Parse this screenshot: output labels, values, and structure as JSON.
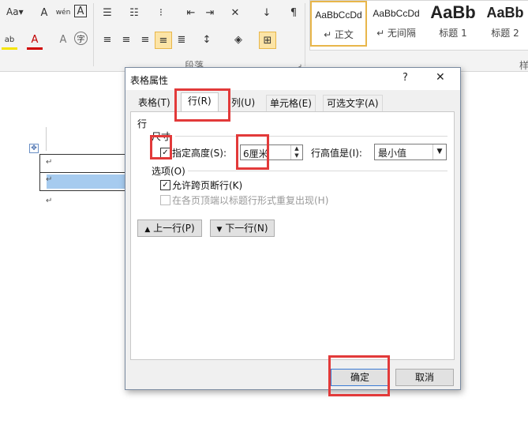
{
  "ribbon": {
    "font_size_label": "Aa",
    "phonetic_icon_label": "wén",
    "letter_a": "A",
    "char_label": "字",
    "shading_label": "ab",
    "paragraph_group_label": "段落",
    "styles_group_label": "样",
    "styles": [
      {
        "sample": "AaBbCcDd",
        "name": "↵ 正文"
      },
      {
        "sample": "AaBbCcDd",
        "name": "↵ 无间隔"
      },
      {
        "sample": "AaBb",
        "name": "标题 1"
      },
      {
        "sample": "AaBb",
        "name": "标题 2"
      }
    ]
  },
  "document": {
    "para_mark": "↵"
  },
  "dialog": {
    "title": "表格属性",
    "help_glyph": "?",
    "close_glyph": "✕",
    "tabs": [
      "表格(T)",
      "行(R)",
      "列(U)",
      "单元格(E)",
      "可选文字(A)"
    ],
    "section_row": "行",
    "size_label": "尺寸",
    "specify_height_label": "指定高度(S):",
    "height_value": "6厘米",
    "row_height_is_label": "行高值是(I):",
    "row_height_mode": "最小值",
    "options_label": "选项(O)",
    "allow_break_label": "允许跨页断行(K)",
    "repeat_header_label": "在各页顶端以标题行形式重复出现(H)",
    "prev_row_label": "上一行(P)",
    "next_row_label": "下一行(N)",
    "ok_label": "确定",
    "cancel_label": "取消"
  },
  "colors": {
    "highlight_red": "#e23a3a",
    "selection_blue": "#a6cbef"
  }
}
